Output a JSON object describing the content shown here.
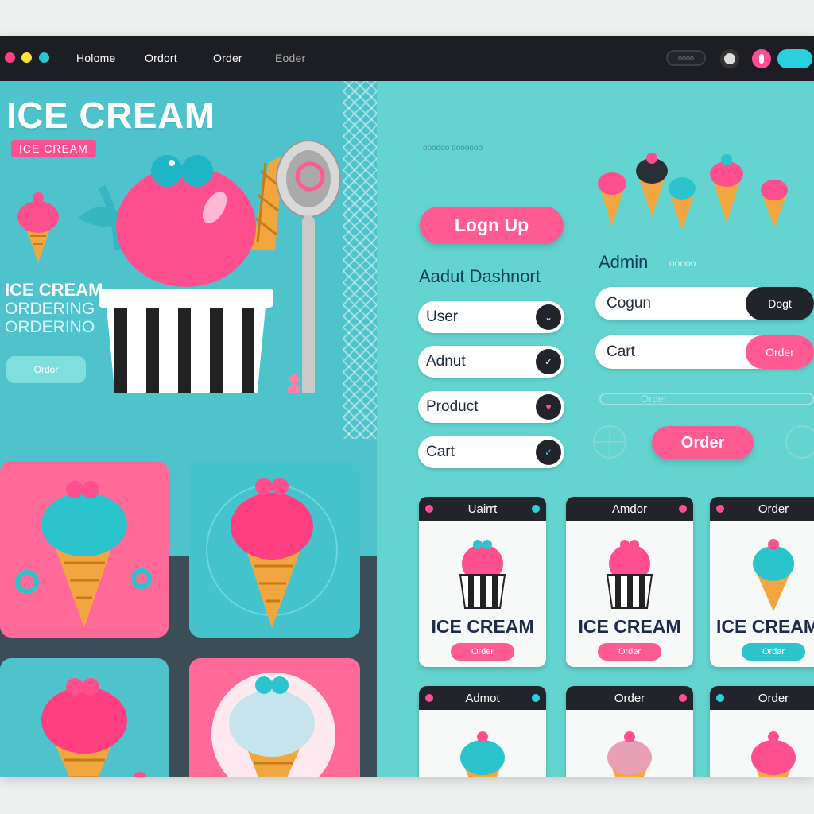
{
  "titlebar": {
    "nav": [
      "Holome",
      "Ordort",
      "Order",
      "Eoder"
    ],
    "search_text": "oooo",
    "traffic_colors": [
      "#ff3f7f",
      "#ffe23a",
      "#28c7d8"
    ]
  },
  "hero": {
    "title": "ICE CREAM",
    "tag": "ICE CREAM",
    "subtitle_1": "ICE CREAM",
    "subtitle_2": "ORDERING",
    "subtitle_3": "ORDERINO",
    "button": "Ordor"
  },
  "right": {
    "faded_caption": "oooooo ooooooo",
    "signup_button": "Logn Up",
    "dashboard_title": "Aadut Dashnort",
    "admin_title": "Admin",
    "admin_faded": "ooooo",
    "menu": [
      {
        "label": "User",
        "icon": "chevron-down-icon",
        "glyph": "⌄"
      },
      {
        "label": "Adnut",
        "icon": "check-icon",
        "glyph": "✓"
      },
      {
        "label": "Product",
        "icon": "heart-icon",
        "glyph": "♥"
      },
      {
        "label": "Cart",
        "icon": "check-icon",
        "glyph": "✓"
      }
    ],
    "wide_rows": [
      {
        "label": "Cogun",
        "end": "Dogt",
        "end_color": "#22242c"
      },
      {
        "label": "Cart",
        "end": "Order",
        "end_color": "#ff5a92"
      }
    ],
    "faded_order_text": "Order",
    "order_button": "Order"
  },
  "cards": [
    {
      "header": "Uairrt",
      "title": "ICE CREAM",
      "button": "Order",
      "button_color": "#ff5a92"
    },
    {
      "header": "Amdor",
      "title": "ICE CREAM",
      "button": "Order",
      "button_color": "#ff5a92"
    },
    {
      "header": "Order",
      "title": "ICE CREAM",
      "button": "Ordar",
      "button_color": "#2bc4cc"
    },
    {
      "header": "Admot"
    },
    {
      "header": "Order"
    },
    {
      "header": "Order"
    }
  ],
  "colors": {
    "pink": "#ff5a92",
    "teal": "#4fc3cb",
    "dark": "#1d1e24",
    "cone": "#f2a640"
  }
}
